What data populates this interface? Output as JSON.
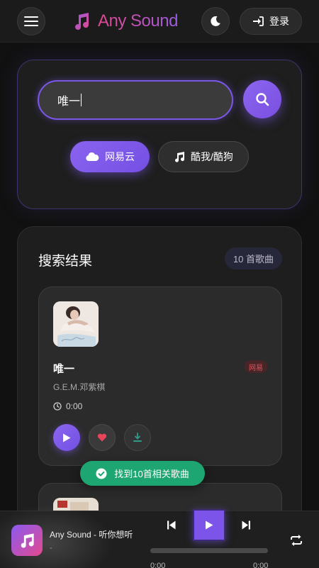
{
  "header": {
    "app_name": "Any Sound",
    "login_label": "登录",
    "icons": {
      "menu": "hamburger-menu-icon",
      "logo": "music-note-icon",
      "theme": "moon-icon",
      "login": "sign-in-icon"
    }
  },
  "search": {
    "query": "唯一",
    "sources": [
      {
        "label": "网易云",
        "icon": "cloud-icon",
        "active": true
      },
      {
        "label": "酷我/酷狗",
        "icon": "music-note-icon",
        "active": false
      }
    ]
  },
  "results": {
    "title": "搜索结果",
    "count_label": "10 首歌曲",
    "songs": [
      {
        "name": "唯一",
        "artist": "G.E.M.邓紫棋",
        "duration": "0:00",
        "source_tag": "网易"
      }
    ]
  },
  "toast": {
    "message": "找到10首相关歌曲"
  },
  "player": {
    "title": "Any Sound - 听你想听",
    "subtitle": "-",
    "current_time": "0:00",
    "total_time": "0:00",
    "progress": 0
  },
  "colors": {
    "accent": "#7c54ea",
    "brand_pink": "#e2478d",
    "success": "#1ea672",
    "like": "#e8455a",
    "tag_red": "#d9535b"
  }
}
